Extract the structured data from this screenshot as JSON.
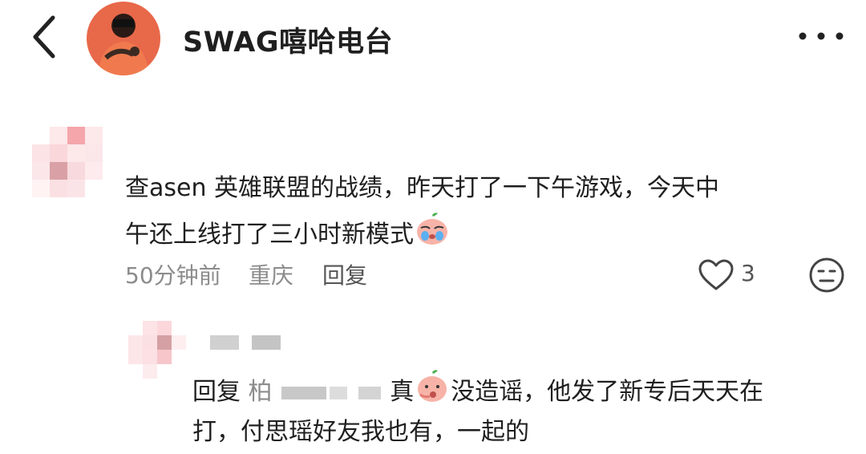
{
  "header": {
    "title": "SWAG嘻哈电台",
    "back_icon": "chevron-left-icon",
    "more_icon": "more-horizontal-icon"
  },
  "comments": [
    {
      "text_line1": "查asen 英雄联盟的战绩，昨天打了一下午游戏，今天中",
      "text_line2": "午还上线打了三小时新模式",
      "emoji": "crying-peach-emoji",
      "time": "50分钟前",
      "location": "重庆",
      "reply_label": "回复",
      "likes": "3",
      "like_icon": "heart-outline-icon",
      "react_icon": "smiley-face-icon"
    }
  ],
  "reply": {
    "prefix": "回复",
    "mention": "柏",
    "text_a": "真",
    "emoji": "shy-peach-emoji",
    "text_b": "没造谣，他发了新专后天天在",
    "line2": "打，付思瑶好友我也有，一起的"
  },
  "colors": {
    "text": "#1f1f1f",
    "muted": "#8c8c8c",
    "avatar_bg": "#e8684a"
  }
}
